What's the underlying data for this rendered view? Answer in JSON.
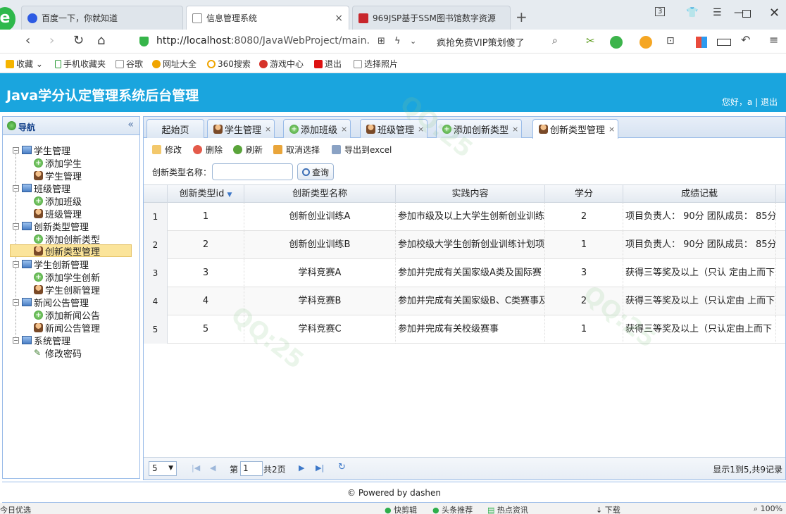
{
  "browser": {
    "tabs": [
      {
        "label": "百度一下，你就知道",
        "active": false
      },
      {
        "label": "信息管理系统",
        "active": true
      },
      {
        "label": "969JSP基于SSM图书馆数字资源",
        "active": false
      }
    ],
    "tab_count": "3",
    "url_host": "http://localhost",
    "url_rest": ":8080/JavaWebProject/main.",
    "promo": "疯抢免费VIP策划傻了"
  },
  "bookmarks": [
    "收藏",
    "手机收藏夹",
    "谷歌",
    "网址大全",
    "360搜索",
    "游戏中心",
    "退出",
    "选择照片"
  ],
  "app": {
    "title": "Java学分认定管理系统后台管理",
    "greeting": "您好，a",
    "separator": "|",
    "logout": "退出"
  },
  "nav": {
    "title": "导航",
    "collapse_glyph": "«",
    "items": [
      {
        "label": "学生管理"
      },
      {
        "label": "添加学生"
      },
      {
        "label": "学生管理"
      },
      {
        "label": "班级管理"
      },
      {
        "label": "添加班级"
      },
      {
        "label": "班级管理"
      },
      {
        "label": "创新类型管理"
      },
      {
        "label": "添加创新类型"
      },
      {
        "label": "创新类型管理"
      },
      {
        "label": "学生创新管理"
      },
      {
        "label": "添加学生创新"
      },
      {
        "label": "学生创新管理"
      },
      {
        "label": "新闻公告管理"
      },
      {
        "label": "添加新闻公告"
      },
      {
        "label": "新闻公告管理"
      },
      {
        "label": "系统管理"
      },
      {
        "label": "修改密码"
      }
    ]
  },
  "page_tabs": [
    "起始页",
    "学生管理",
    "添加班级",
    "班级管理",
    "添加创新类型",
    "创新类型管理"
  ],
  "toolbar": {
    "edit": "修改",
    "delete": "删除",
    "refresh": "刷新",
    "unselect": "取消选择",
    "export": "导出到excel"
  },
  "search": {
    "label": "创新类型名称：",
    "value": "",
    "button": "查询"
  },
  "grid": {
    "columns": [
      "创新类型id",
      "创新类型名称",
      "实践内容",
      "学分",
      "成绩记载"
    ],
    "rows": [
      {
        "n": "1",
        "id": "1",
        "name": "创新创业训练A",
        "content": "参加市级及以上大学生创新创业训练",
        "credit": "2",
        "record": "项目负责人： 90分 团队成员： 85分"
      },
      {
        "n": "2",
        "id": "2",
        "name": "创新创业训练B",
        "content": "参加校级大学生创新创业训练计划项",
        "credit": "1",
        "record": "项目负责人： 90分 团队成员： 85分"
      },
      {
        "n": "3",
        "id": "3",
        "name": "学科竞赛A",
        "content": "参加并完成有关国家级A类及国际赛",
        "credit": "3",
        "record": "获得三等奖及以上（只认 定由上而下"
      },
      {
        "n": "4",
        "id": "4",
        "name": "学科竞赛B",
        "content": "参加并完成有关国家级B、C类赛事及",
        "credit": "2",
        "record": "获得三等奖及以上（只认定由 上而下"
      },
      {
        "n": "5",
        "id": "5",
        "name": "学科竞赛C",
        "content": "参加并完成有关校级赛事",
        "credit": "1",
        "record": "获得三等奖及以上（只认定由上而下"
      }
    ]
  },
  "pager": {
    "page_size": "5",
    "page_prefix": "第",
    "page": "1",
    "total_pages": "共2页",
    "summary": "显示1到5,共9记录"
  },
  "footer": "© Powered by dashen",
  "status": {
    "left": "今日优选",
    "items": [
      "快剪辑",
      "头条推荐",
      "热点资讯",
      "下载",
      "100%"
    ]
  },
  "colors": {
    "header": "#1aa5de",
    "panel_border": "#99bbe8",
    "selected": "#fbe49a"
  }
}
